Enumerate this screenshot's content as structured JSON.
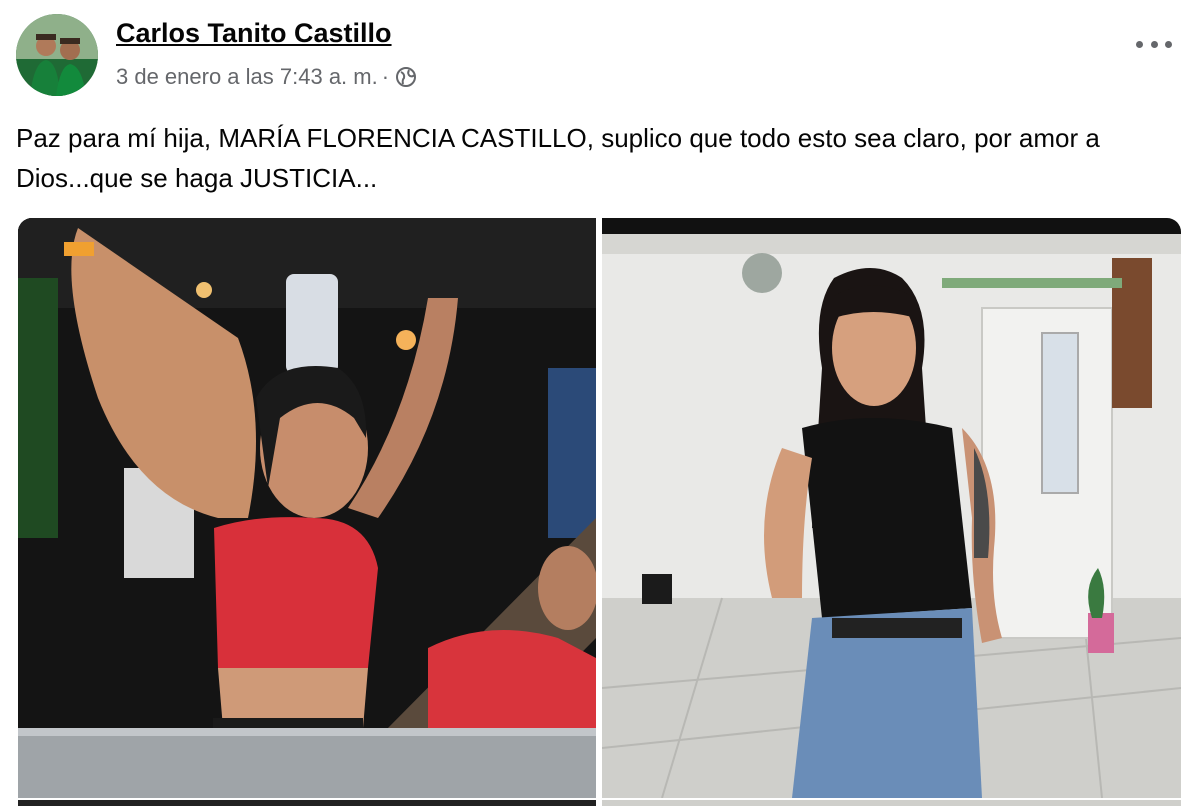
{
  "post": {
    "author": "Carlos Tanito Castillo",
    "timestamp": "3 de enero a las 7:43 a. m.",
    "separator": "·",
    "privacy_icon": "globe-icon",
    "more_icon": "more-options-icon",
    "caption": "Paz para mí hija, MARÍA FLORENCIA CASTILLO, suplico que todo esto sea claro, por amor a Dios...que se haga JUSTICIA..."
  },
  "colors": {
    "text_primary": "#050505",
    "text_secondary": "#65676b",
    "background": "#ffffff"
  }
}
